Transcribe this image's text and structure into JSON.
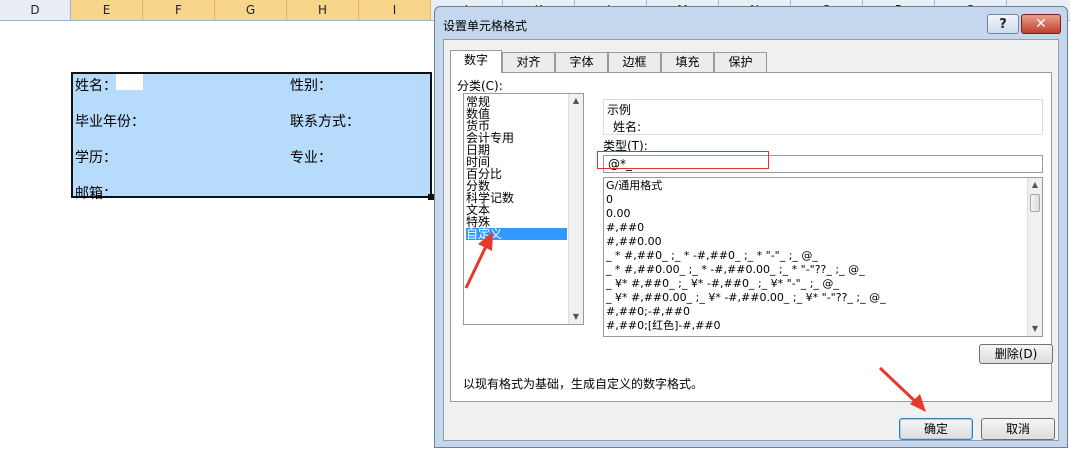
{
  "sheet": {
    "columns": [
      "D",
      "E",
      "F",
      "G",
      "H",
      "I",
      "J",
      "K",
      "L",
      "M",
      "N",
      "O",
      "P",
      "Q"
    ],
    "cells": [
      {
        "text": "姓名："
      },
      {
        "text": "性别："
      },
      {
        "text": "毕业年份："
      },
      {
        "text": "联系方式："
      },
      {
        "text": "学历："
      },
      {
        "text": "专业："
      },
      {
        "text": "邮箱："
      }
    ]
  },
  "dialog": {
    "title": "设置单元格格式",
    "help": "?",
    "close": "✕",
    "tabs": [
      "数字",
      "对齐",
      "字体",
      "边框",
      "填充",
      "保护"
    ],
    "active_tab": "数字",
    "category_label": "分类(C):",
    "categories": [
      "常规",
      "数值",
      "货币",
      "会计专用",
      "日期",
      "时间",
      "百分比",
      "分数",
      "科学记数",
      "文本",
      "特殊",
      "自定义"
    ],
    "selected_category": "自定义",
    "sample_label": "示例",
    "sample_value": "姓名:",
    "type_label": "类型(T):",
    "type_value": "@*_",
    "formats": [
      "G/通用格式",
      "0",
      "0.00",
      "#,##0",
      "#,##0.00",
      "_ * #,##0_ ;_ * -#,##0_ ;_ * \"-\"_ ;_ @_",
      "_ * #,##0.00_ ;_ * -#,##0.00_ ;_ * \"-\"??_ ;_ @_",
      "_ ¥* #,##0_ ;_ ¥* -#,##0_ ;_ ¥* \"-\"_ ;_ @_",
      "_ ¥* #,##0.00_ ;_ ¥* -#,##0.00_ ;_ ¥* \"-\"??_ ;_ @_",
      "#,##0;-#,##0",
      "#,##0;[红色]-#,##0"
    ],
    "delete_button": "删除(D)",
    "description": "以现有格式为基础，生成自定义的数字格式。",
    "ok_button": "确定",
    "cancel_button": "取消"
  },
  "colors": {
    "selection_fill": "#b7dbfb",
    "highlight_red": "#e03030",
    "list_selected": "#3399ff",
    "arrow_red": "#e6392c"
  }
}
